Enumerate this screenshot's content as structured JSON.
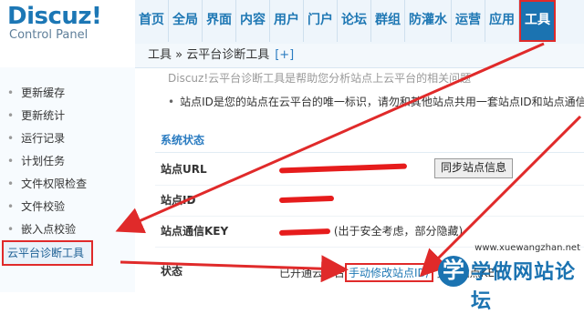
{
  "logo": {
    "brand": "Discuz!",
    "subtitle": "Control Panel"
  },
  "topnav": {
    "tabs": [
      "首页",
      "全局",
      "界面",
      "内容",
      "用户",
      "门户",
      "论坛",
      "群组",
      "防灌水",
      "运营",
      "应用",
      "工具"
    ],
    "active": "工具"
  },
  "breadcrumb": {
    "text": "工具 » 云平台诊断工具",
    "plus": "[+]"
  },
  "sidebar": {
    "items": [
      "更新缓存",
      "更新统计",
      "运行记录",
      "计划任务",
      "文件权限检查",
      "文件校验",
      "嵌入点校验",
      "云平台诊断工具"
    ],
    "active_index": 7
  },
  "tips": [
    "Discuz!云平台诊断工具是帮助您分析站点上云平台的相关问题",
    "站点ID是您的站点在云平台的唯一标识，请勿和其他站点共用一套站点ID和站点通信KEY"
  ],
  "status": {
    "section_title": "系统状态",
    "rows": [
      {
        "label": "站点URL",
        "button": "同步站点信息"
      },
      {
        "label": "站点ID",
        "value": ""
      },
      {
        "label": "站点通信KEY",
        "value_suffix": "(出于安全考虑，部分隐藏)"
      },
      {
        "label": "状态",
        "value_prefix": "已开通云平台",
        "link": "手动修改站点ID/",
        "value_tail": "更换站点KEY"
      }
    ]
  },
  "watermark": {
    "glyph": "学",
    "text": "学做网站论坛",
    "url": "www.xuewangzhan.net"
  },
  "colors": {
    "accent": "#1b73b1",
    "highlight": "#e02a2a"
  }
}
